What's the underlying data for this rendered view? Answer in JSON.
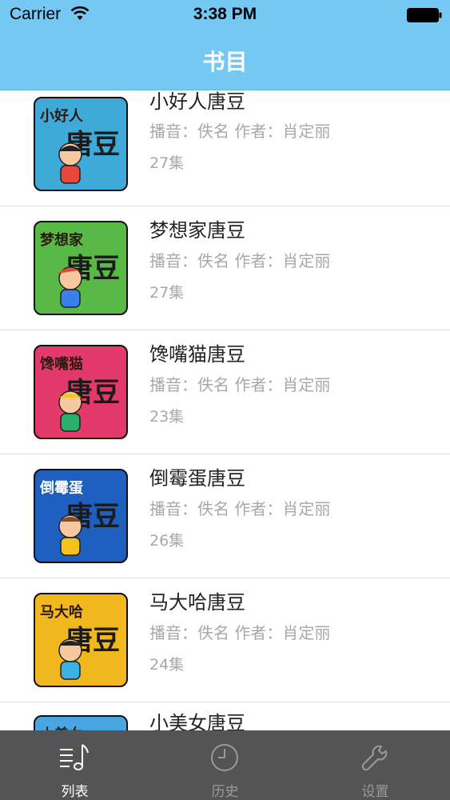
{
  "status_bar": {
    "carrier": "Carrier",
    "time": "3:38 PM"
  },
  "nav": {
    "title": "书目"
  },
  "books": [
    {
      "title": "小好人唐豆",
      "meta": "播音：佚名 作者：肖定丽",
      "episodes": "27集",
      "cover_label": "小好人",
      "cover_main": "唐豆",
      "cover_color": "#3fa9d8"
    },
    {
      "title": "梦想家唐豆",
      "meta": "播音：佚名 作者：肖定丽",
      "episodes": "27集",
      "cover_label": "梦想家",
      "cover_main": "唐豆",
      "cover_color": "#58b947"
    },
    {
      "title": "馋嘴猫唐豆",
      "meta": "播音：佚名 作者：肖定丽",
      "episodes": "23集",
      "cover_label": "馋嘴猫",
      "cover_main": "唐豆",
      "cover_color": "#e23a6a"
    },
    {
      "title": "倒霉蛋唐豆",
      "meta": "播音：佚名 作者：肖定丽",
      "episodes": "26集",
      "cover_label": "倒霉蛋",
      "cover_main": "唐豆",
      "cover_color": "#1f5fbf"
    },
    {
      "title": "马大哈唐豆",
      "meta": "播音：佚名 作者：肖定丽",
      "episodes": "24集",
      "cover_label": "马大哈",
      "cover_main": "唐豆",
      "cover_color": "#f2b81f"
    },
    {
      "title": "小美女唐豆",
      "meta": "",
      "episodes": "",
      "cover_label": "小美女",
      "cover_main": "",
      "cover_color": "#4aa6e0"
    }
  ],
  "tabs": [
    {
      "label": "列表",
      "icon": "music-list-icon",
      "active": true
    },
    {
      "label": "历史",
      "icon": "clock-icon",
      "active": false
    },
    {
      "label": "设置",
      "icon": "wrench-icon",
      "active": false
    }
  ]
}
